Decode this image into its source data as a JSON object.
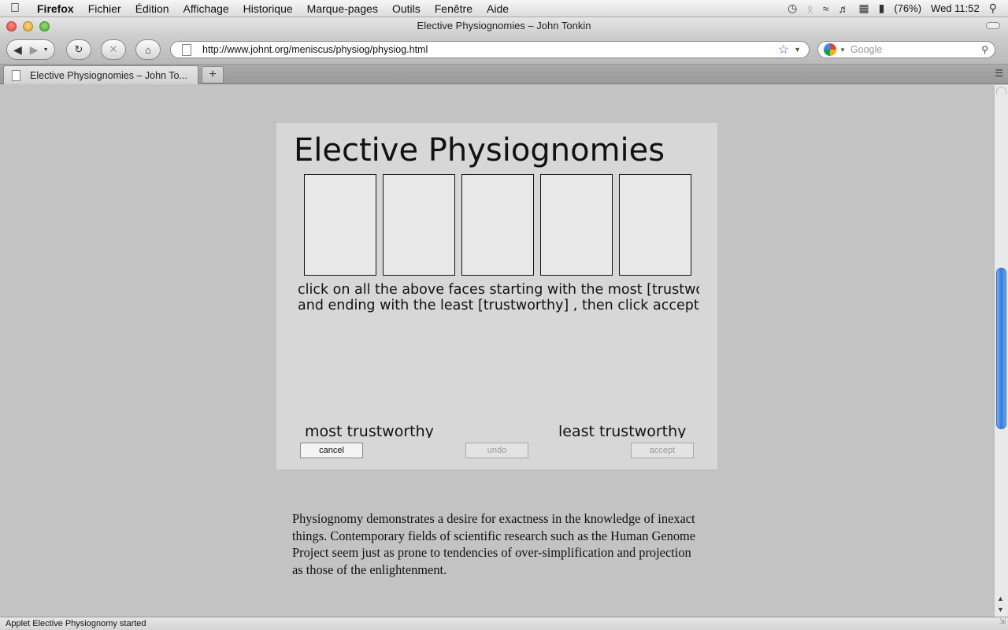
{
  "menubar": {
    "app": "Firefox",
    "items": [
      "Fichier",
      "Édition",
      "Affichage",
      "Historique",
      "Marque-pages",
      "Outils",
      "Fenêtre",
      "Aide"
    ],
    "battery": "(76%)",
    "clock": "Wed 11:52"
  },
  "window": {
    "title": "Elective Physiognomies – John Tonkin"
  },
  "toolbar": {
    "url": "http://www.johnt.org/meniscus/physiog/physiog.html",
    "search_placeholder": "Google"
  },
  "tabs": [
    {
      "label": "Elective Physiognomies – John To..."
    }
  ],
  "applet": {
    "title": "Elective Physiognomies",
    "instructions_line1": "click on all the above faces starting with the most [trustworthy]",
    "instructions_line2": "and ending with the least [trustworthy] , then click accept.",
    "label_most": "most trustworthy",
    "label_least": "least trustworthy",
    "buttons": {
      "cancel": "cancel",
      "undo": "undo",
      "accept": "accept"
    }
  },
  "paragraph": "Physiognomy demonstrates a desire for exactness in the knowledge of inexact things. Contemporary fields of scientific research such as the Human Genome Project seem just as prone to tendencies of over-simplification and projection as those of the enlightenment.",
  "status": "Applet Elective Physiognomy started",
  "colors": {
    "accent": "#2f7de0",
    "applet_bg": "#d7d7d7",
    "page_bg": "#c3c3c3"
  }
}
